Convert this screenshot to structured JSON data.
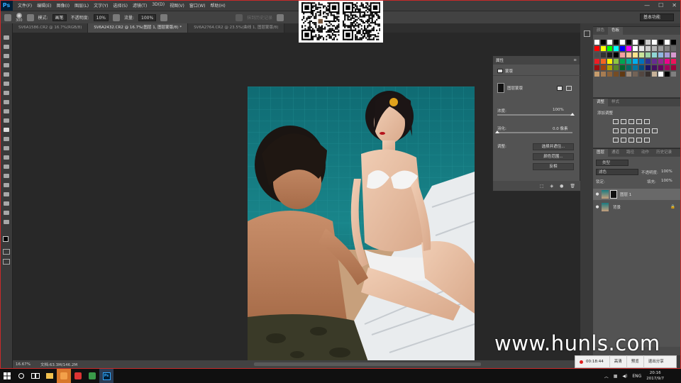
{
  "app": {
    "logo": "Ps",
    "menu": [
      "文件(F)",
      "编辑(E)",
      "图像(I)",
      "图层(L)",
      "文字(Y)",
      "选择(S)",
      "滤镜(T)",
      "3D(D)",
      "视图(V)",
      "窗口(W)",
      "帮助(H)"
    ]
  },
  "options": {
    "brush_size": "300",
    "mode_label": "模式:",
    "mode_value": "画笔",
    "opacity_label": "不透明度:",
    "opacity_value": "10%",
    "flow_label": "流量:",
    "flow_value": "100%",
    "history_label": "抹到历史记录",
    "workspace": "基本功能"
  },
  "tabs": [
    "SV6A1586.CR2 @ 16.7%(RGB/8)",
    "SV6A2432.CR2 @ 16.7%(图层 1, 图层蒙版/8) *",
    "SV6A2764.CR2 @ 23.5%(曲线 1, 图层蒙版/8)"
  ],
  "status": {
    "zoom": "16.67%",
    "doc": "文档:63.3M/146.2M"
  },
  "properties": {
    "title": "属性",
    "section": "蒙版",
    "mask_label": "图层蒙版",
    "density_label": "浓度:",
    "density_value": "100%",
    "density_level": 1.0,
    "feather_label": "羽化:",
    "feather_value": "0.0 像素",
    "feather_level": 0.0,
    "adjust_label": "调整:",
    "btn_select_mask": "选择并遮住...",
    "btn_color_range": "颜色范围...",
    "btn_invert": "反相"
  },
  "panels": {
    "swatch_tabs": [
      "颜色",
      "色板"
    ],
    "adjust_tabs": [
      "调整",
      "样式"
    ],
    "adjust_title": "添加调整",
    "layers_tabs": [
      "图层",
      "通道",
      "路径",
      "动作",
      "历史记录"
    ],
    "kind_label": "类型",
    "blend_mode": "滤色",
    "opacity_label": "不透明度:",
    "opacity_value": "100%",
    "lock_label": "锁定:",
    "fill_label": "填充:",
    "fill_value": "100%",
    "layers": [
      {
        "name": "图层 1",
        "selected": true
      },
      {
        "name": "背景",
        "selected": false
      }
    ]
  },
  "watermark": "www.hunls.com",
  "recorder": {
    "time": "00:18:44",
    "btn_hd": "高清",
    "btn_preview": "预览",
    "btn_exit": "退出分享"
  },
  "taskbar": {
    "lang": "ENG",
    "time": "20:16",
    "date": "2017/9/7"
  },
  "colors": {
    "accent": "#31a8ff",
    "frame": "#c92a2a",
    "record": "#e02020"
  }
}
